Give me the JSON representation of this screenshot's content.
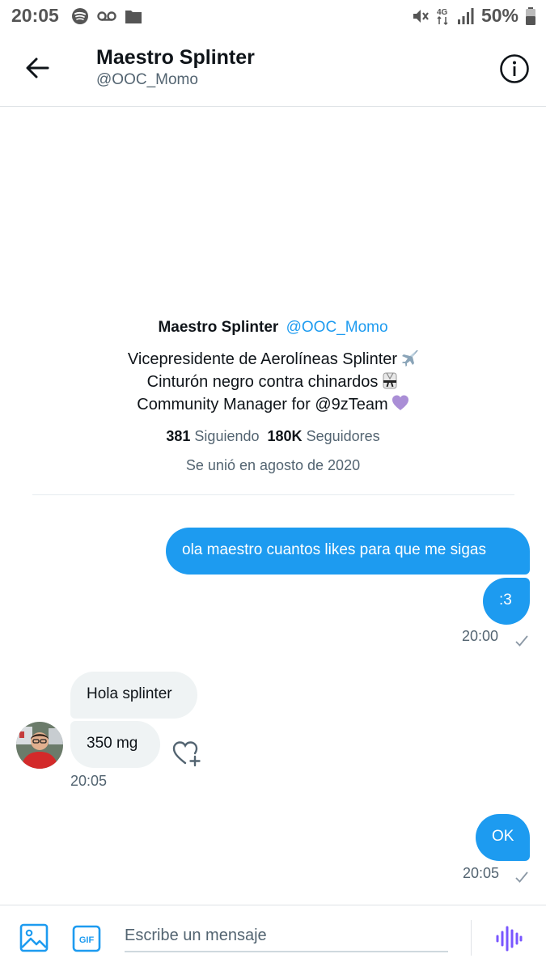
{
  "status_bar": {
    "time": "20:05",
    "battery": "50%",
    "network": "4G",
    "left_icons": [
      "spotify-icon",
      "voicemail-icon",
      "folder-icon"
    ],
    "right_icons": [
      "mute-icon",
      "data-4g-icon",
      "signal-icon",
      "battery-icon"
    ]
  },
  "header": {
    "name": "Maestro Splinter",
    "handle": "@OOC_Momo"
  },
  "profile": {
    "name": "Maestro Splinter",
    "handle": "@OOC_Momo",
    "bio": [
      "Vicepresidente de Aerolíneas Splinter",
      "Cinturón negro contra chinardos",
      "Community Manager for @9zTeam"
    ],
    "bio_emojis": [
      "airplane-emoji",
      "martial-arts-uniform-emoji",
      "purple-heart-emoji"
    ],
    "following_count": "381",
    "following_label": "Siguiendo",
    "followers_count": "180K",
    "followers_label": "Seguidores",
    "joined": "Se unió en agosto de 2020"
  },
  "messages": {
    "sent_1": "ola maestro cuantos likes para que me sigas",
    "sent_2": ":3",
    "sent_time_1": "20:00",
    "recv_1": "Hola splinter",
    "recv_2": "350 mg",
    "recv_time": "20:05",
    "sent_3": "OK",
    "sent_time_2": "20:05"
  },
  "composer": {
    "placeholder": "Escribe un mensaje",
    "gif_label": "GIF"
  },
  "colors": {
    "accent": "#1d9bf0",
    "received_bubble": "#eff3f4",
    "secondary_text": "#536471",
    "voice_icon": "#7856ff"
  }
}
